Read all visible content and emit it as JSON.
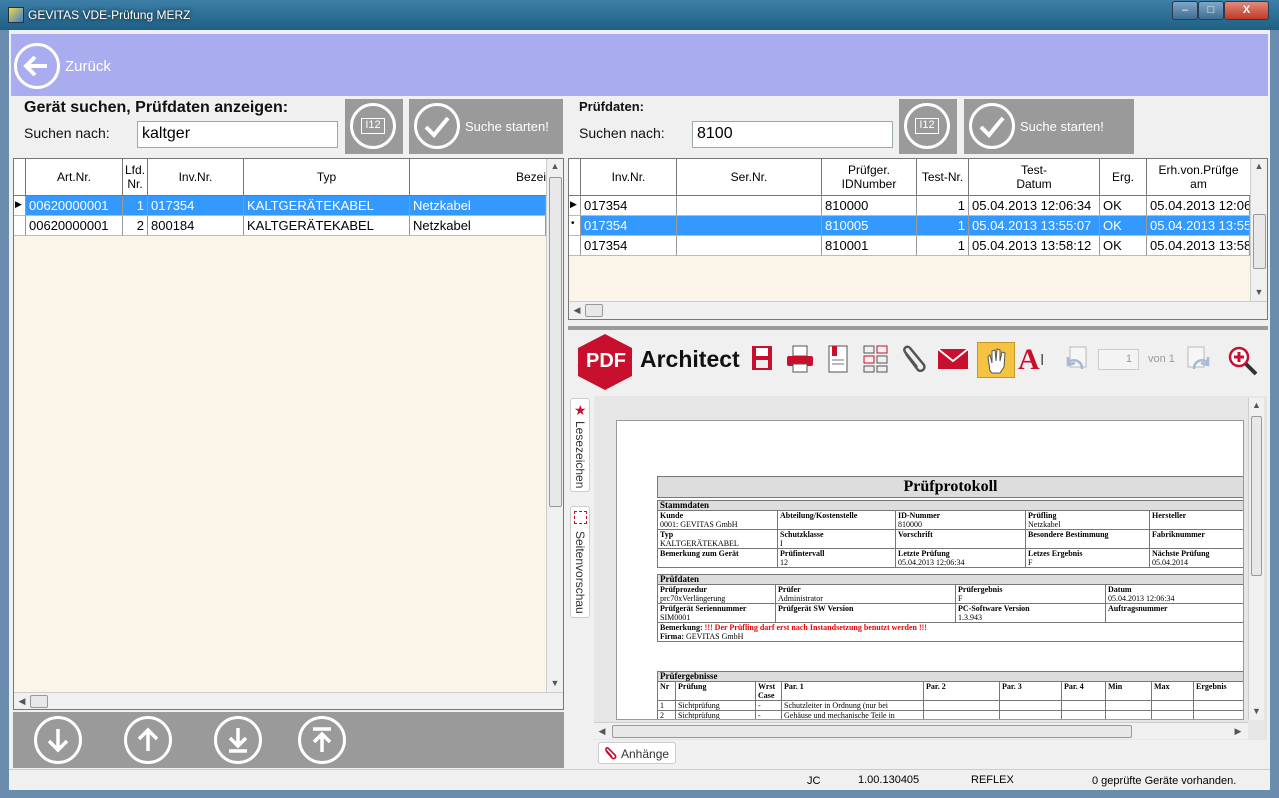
{
  "window": {
    "title": "GEVITAS VDE-Prüfung MERZ",
    "close_label": "X"
  },
  "header": {
    "back_label": "Zurück"
  },
  "left_search": {
    "heading": "Gerät suchen, Prüfdaten anzeigen:",
    "search_label": "Suchen  nach:",
    "search_value": "kaltger",
    "start_label": "Suche starten!",
    "icon_text": "I12"
  },
  "right_search": {
    "heading": "Prüfdaten:",
    "search_label": "Suchen  nach:",
    "search_value": "8100",
    "start_label": "Suche starten!",
    "icon_text": "I12"
  },
  "device_table": {
    "columns": [
      "Art.Nr.",
      "Lfd.\nNr.",
      "Inv.Nr.",
      "Typ",
      "Bezei"
    ],
    "rows": [
      {
        "art": "00620000001",
        "lfd": "1",
        "inv": "017354",
        "typ": "KALTGERÄTEKABEL",
        "bez": "Netzkabel"
      },
      {
        "art": "00620000001",
        "lfd": "2",
        "inv": "800184",
        "typ": "KALTGERÄTEKABEL",
        "bez": "Netzkabel"
      }
    ]
  },
  "test_table": {
    "columns": [
      "Inv.Nr.",
      "Ser.Nr.",
      "Prüfger.\nIDNumber",
      "Test-Nr.",
      "Test-\nDatum",
      "Erg.",
      "Erh.von.Prüfge\nam"
    ],
    "rows": [
      {
        "inv": "017354",
        "ser": "",
        "id": "810000",
        "nr": "1",
        "datum": "05.04.2013 12:06:34",
        "erg": "OK",
        "erh": "05.04.2013 12:06"
      },
      {
        "inv": "017354",
        "ser": "",
        "id": "810005",
        "nr": "1",
        "datum": "05.04.2013 13:55:07",
        "erg": "OK",
        "erh": "05.04.2013 13:55"
      },
      {
        "inv": "017354",
        "ser": "",
        "id": "810001",
        "nr": "1",
        "datum": "05.04.2013 13:58:12",
        "erg": "OK",
        "erh": "05.04.2013 13:58"
      }
    ]
  },
  "pdf": {
    "logo_text": "PDF",
    "brand": "Architect",
    "page_value": "1",
    "page_of": "von 1",
    "tab_bookmarks": "Lesezeichen",
    "tab_preview": "Seitenvorschau",
    "tab_attachments": "Anhänge",
    "doc": {
      "title": "Prüfprotokoll",
      "sec_stammdaten": "Stammdaten",
      "kunde_l": "Kunde",
      "kunde_v": "0001: GEVITAS GmbH",
      "abt_l": "Abteilung/Kostenstelle",
      "idn_l": "ID-Nummer",
      "idn_v": "810000",
      "pruefling_l": "Prüfling",
      "pruefling_v": "Netzkabel",
      "herst_l": "Hersteller",
      "typ_l": "Typ",
      "typ_v": "KALTGERÄTEKABEL",
      "sk_l": "Schutzklasse",
      "sk_v": "I",
      "vor_l": "Vorschrift",
      "bb_l": "Besondere Bestimmung",
      "fab_l": "Fabriknummer",
      "bem_l": "Bemerkung zum Gerät",
      "pi_l": "Prüfintervall",
      "pi_v": "12",
      "lp_l": "Letzte Prüfung",
      "lp_v": "05.04.2013 12:06:34",
      "le_l": "Letzes Ergebnis",
      "le_v": "F",
      "np_l": "Nächste Prüfung",
      "np_v": "05.04.2014",
      "sec_pruefdaten": "Prüfdaten",
      "proz_l": "Prüfprozedur",
      "proz_v": "prc70xVerlängerung",
      "pruefer_l": "Prüfer",
      "pruefer_v": "Administrator",
      "erg_l": "Prüfergebnis",
      "erg_v": "F",
      "dat_l": "Datum",
      "dat_v": "05.04.2013 12:06:34",
      "sn_l": "Prüfgerät Seriennummer",
      "sn_v": "SIM0001",
      "sw_l": "Prüfgerät SW Version",
      "pcsw_l": "PC-Software Version",
      "pcsw_v": "1.3.943",
      "auf_l": "Auftragsnummer",
      "bemerk_l": "Bemerkung:",
      "bemerk_v": "!!! Der Prüfling darf erst nach Instandsetzung benutzt werden !!!",
      "firma_l": "Firma:",
      "firma_v": "GEVITAS GmbH",
      "sec_ergebnisse": "Prüfergebnisse",
      "res_cols": [
        "Nr",
        "Prüfung",
        "Wrst Case",
        "Par. 1",
        "Par. 2",
        "Par. 3",
        "Par. 4",
        "Min",
        "Max",
        "Ergebnis"
      ],
      "res_rows": [
        {
          "nr": "1",
          "pr": "Sichtprüfung",
          "wc": "-",
          "p1": "Schutzleiter in Ordnung (nur bei"
        },
        {
          "nr": "2",
          "pr": "Sichtprüfung",
          "wc": "-",
          "p1": "Gehäuse und mechanische Teile in"
        }
      ]
    }
  },
  "status": {
    "user": "JC",
    "version": "1.00.130405",
    "mode": "REFLEX",
    "message": "0 geprüfte Geräte vorhanden."
  },
  "colors": {
    "header": "#a9acee",
    "selection": "#3399ff",
    "panel": "#9a9a9a",
    "grid_bg": "#faf5e8"
  }
}
